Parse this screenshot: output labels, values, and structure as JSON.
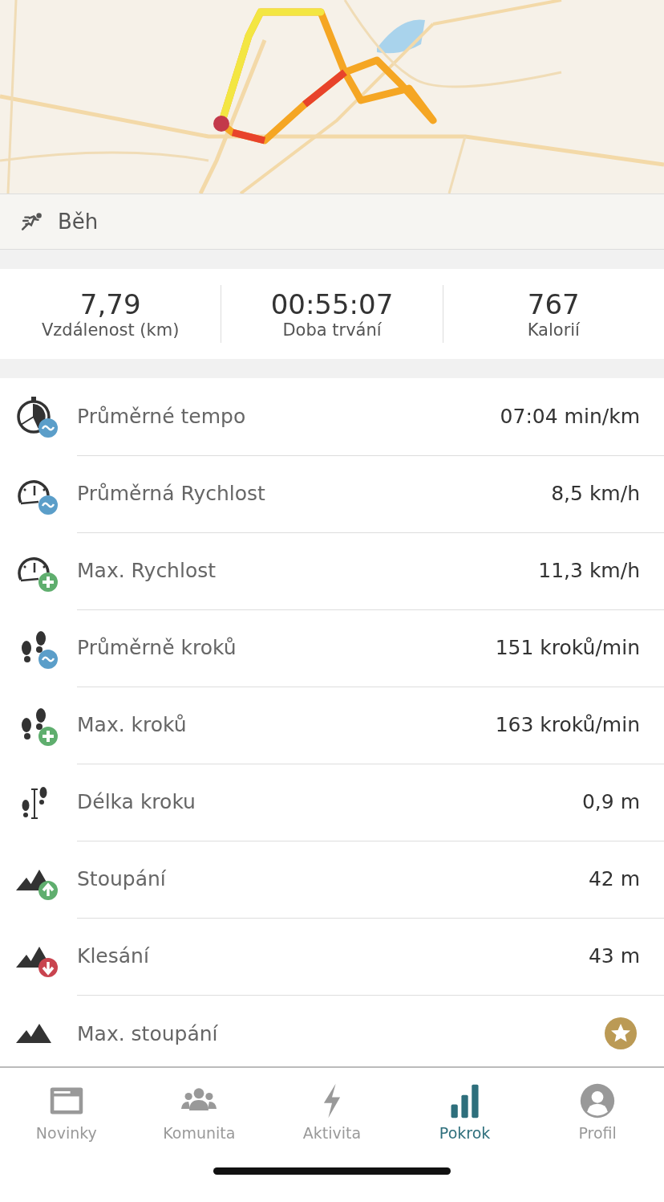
{
  "activity": {
    "label": "Běh"
  },
  "stats": [
    {
      "value": "7,79",
      "label": "Vzdálenost (km)"
    },
    {
      "value": "00:55:07",
      "label": "Doba trvání"
    },
    {
      "value": "767",
      "label": "Kalorií"
    }
  ],
  "metrics": [
    {
      "kind": "avgpace",
      "label": "Průměrné tempo",
      "value": "07:04 min/km"
    },
    {
      "kind": "avgspeed",
      "label": "Průměrná Rychlost",
      "value": "8,5 km/h"
    },
    {
      "kind": "maxspeed",
      "label": "Max. Rychlost",
      "value": "11,3 km/h"
    },
    {
      "kind": "avgcadence",
      "label": "Průměrně kroků",
      "value": "151 kroků/min"
    },
    {
      "kind": "maxcadence",
      "label": "Max. kroků",
      "value": "163 kroků/min"
    },
    {
      "kind": "stride",
      "label": "Délka kroku",
      "value": "0,9 m"
    },
    {
      "kind": "ascent",
      "label": "Stoupání",
      "value": "42 m"
    },
    {
      "kind": "descent",
      "label": "Klesání",
      "value": "43 m"
    },
    {
      "kind": "maxascent",
      "label": "Max. stoupání"
    }
  ],
  "tabs": [
    {
      "label": "Novinky",
      "selected": false
    },
    {
      "label": "Komunita",
      "selected": false
    },
    {
      "label": "Aktivita",
      "selected": false
    },
    {
      "label": "Pokrok",
      "selected": true
    },
    {
      "label": "Profil",
      "selected": false
    }
  ]
}
